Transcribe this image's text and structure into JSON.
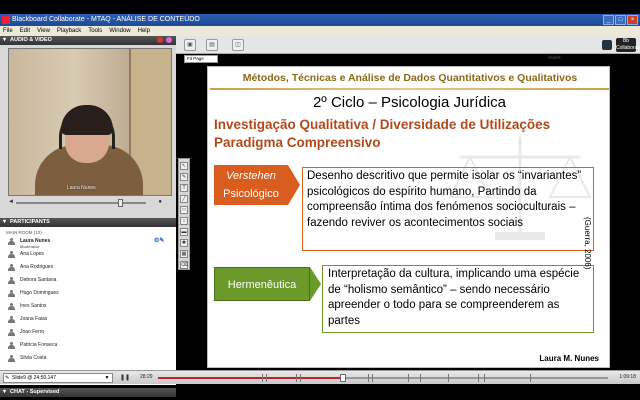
{
  "window": {
    "title": "Blackboard Collaborate - MTAQ - ANÁLISE DE CONTEÚDO"
  },
  "menu": [
    "File",
    "Edit",
    "View",
    "Playback",
    "Tools",
    "Window",
    "Help"
  ],
  "av": {
    "header": "AUDIO & VIDEO",
    "video_caption": "Laura Nunes"
  },
  "participants": {
    "header": "PARTICIPANTS",
    "room": "MAIN ROOM (10)",
    "list": [
      {
        "name": "Laura Nunes",
        "role": "Moderator"
      },
      {
        "name": "Ana Lopes"
      },
      {
        "name": "Ana Rodrigues"
      },
      {
        "name": "Debora Santana"
      },
      {
        "name": "Hugo Domingues"
      },
      {
        "name": "Ines Santos"
      },
      {
        "name": "Joana Faias"
      },
      {
        "name": "Joao Ferro"
      },
      {
        "name": "Patricia Fonseca"
      },
      {
        "name": "Silvia Costa"
      }
    ]
  },
  "chat": {
    "header": "CHAT - Supervised"
  },
  "whiteboard": {
    "zoom": "Fit Page",
    "slide_tab": "Slide9",
    "brand": "Bb Collaborate"
  },
  "slide": {
    "top": "Métodos, Técnicas e Análise de Dados Quantitativos  e Qualitativos",
    "title": "2º Ciclo – Psicologia Jurídica",
    "sub1": "Investigação Qualitativa / Diversidade de Utilizações",
    "sub2": "Paradigma Compreensivo",
    "box1_label_a": "Verstehen",
    "box1_label_b": "Psicológico",
    "box1_text": "Desenho descritivo que permite isolar os “invariantes” psicológicos do espírito humano, Partindo da compreensão íntima dos fenómenos socioculturais – fazendo reviver os acontecimentos sociais",
    "box2_label": "Hermenêutica",
    "box2_text": "Interpretação da cultura, implicando uma espécie de “holismo semântico” – sendo necessário apreender o todo para se compreenderem as partes",
    "citation": "(Guerra, 2006)",
    "author": "Laura M. Nunes"
  },
  "playback": {
    "slide_select": "Slide9 @ 24:50.147",
    "time_current": "28:29",
    "time_total": "1:09:18",
    "progress": 0.411
  },
  "colors": {
    "accent_orange": "#d95d1e",
    "accent_green": "#6b9a2a",
    "title_brown": "#b04a1c",
    "progress_red": "#c8202a"
  }
}
